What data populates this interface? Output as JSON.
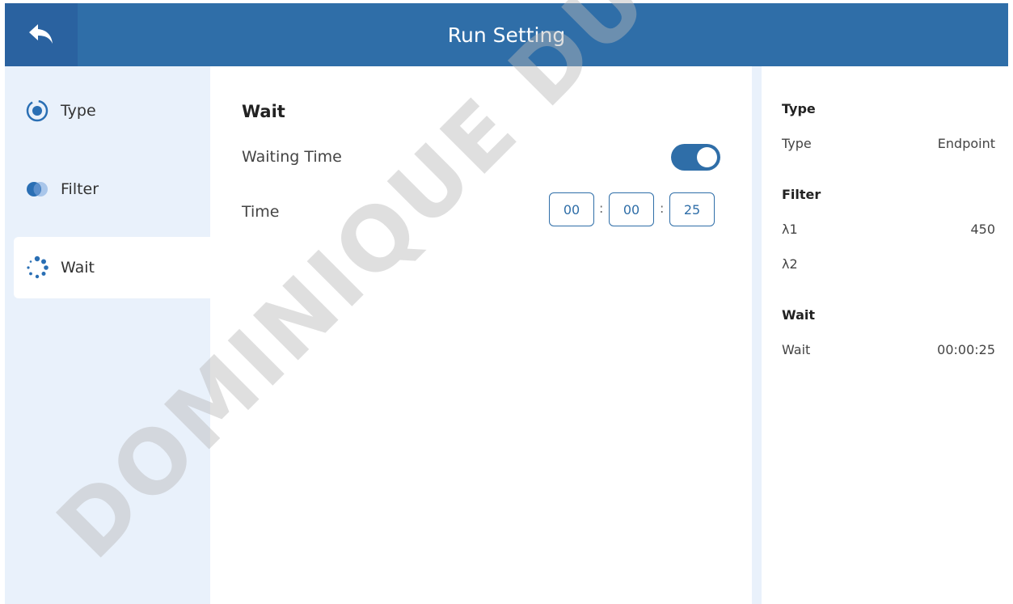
{
  "header": {
    "title": "Run Setting",
    "back_icon": "back-arrow-icon"
  },
  "sidebar": {
    "items": [
      {
        "label": "Type",
        "icon": "radio-target-icon",
        "active": false
      },
      {
        "label": "Filter",
        "icon": "filter-circles-icon",
        "active": false
      },
      {
        "label": "Wait",
        "icon": "loading-dots-icon",
        "active": true
      }
    ]
  },
  "main": {
    "section_title": "Wait",
    "waiting_time_label": "Waiting Time",
    "waiting_time_enabled": true,
    "time_label": "Time",
    "time": {
      "hours": "00",
      "minutes": "00",
      "seconds": "25",
      "separator": ":"
    }
  },
  "summary": {
    "type_heading": "Type",
    "type_key": "Type",
    "type_value": "Endpoint",
    "filter_heading": "Filter",
    "lambda1_key": "λ1",
    "lambda1_value": "450",
    "lambda2_key": "λ2",
    "lambda2_value": "",
    "wait_heading": "Wait",
    "wait_key": "Wait",
    "wait_value": "00:00:25"
  },
  "watermark": "DOMINIQUE DU",
  "colors": {
    "primary": "#2f6ea8",
    "sidebar_bg": "#e9f1fb",
    "accent_icon": "#2a6fb4"
  }
}
